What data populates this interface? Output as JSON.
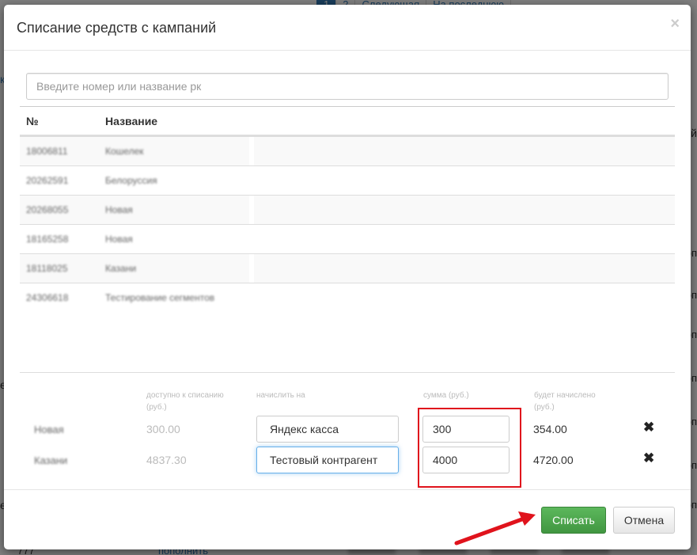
{
  "background": {
    "pager": [
      "1",
      "2",
      "Следующая",
      "На последнюю"
    ],
    "left_snippets": [
      "ко",
      "е",
      "е"
    ],
    "right_snippets": [
      "й",
      "оп",
      "оп",
      "оп",
      "оп",
      "оп",
      "оп",
      "оп"
    ],
    "bottom_number": "777",
    "bottom_link": "пополнить"
  },
  "modal": {
    "title": "Списание средств с кампаний",
    "close_label": "×",
    "search": {
      "placeholder": "Введите номер или название рк",
      "value": ""
    },
    "table": {
      "headers": {
        "num": "№",
        "name": "Название"
      },
      "rows": [
        {
          "num": "18006811",
          "name": "Кошелек"
        },
        {
          "num": "20262591",
          "name": "Белоруссия"
        },
        {
          "num": "20268055",
          "name": "Новая"
        },
        {
          "num": "18165258",
          "name": "Новая"
        },
        {
          "num": "18118025",
          "name": "Казани"
        },
        {
          "num": "24306618",
          "name": "Тестирование сегментов"
        }
      ]
    },
    "writeoff": {
      "labels": {
        "available": "доступно к списанию (руб.)",
        "credit_to": "начислить на",
        "sum": "сумма (руб.)",
        "budget": "будет начислено (руб.)"
      },
      "rows": [
        {
          "name": "Новая",
          "available": "300.00",
          "credit_to": "Яндекс касса",
          "sum": "300",
          "budget": "354.00",
          "remove": "✖"
        },
        {
          "name": "Казани",
          "available": "4837.30",
          "credit_to": "Тестовый контрагент",
          "sum": "4000",
          "budget": "4720.00",
          "remove": "✖"
        }
      ]
    },
    "footer": {
      "submit_label": "Списать",
      "cancel_label": "Отмена"
    }
  },
  "colors": {
    "accent": "#5cb85c",
    "highlight": "#e0131c",
    "link": "#337ab7"
  }
}
